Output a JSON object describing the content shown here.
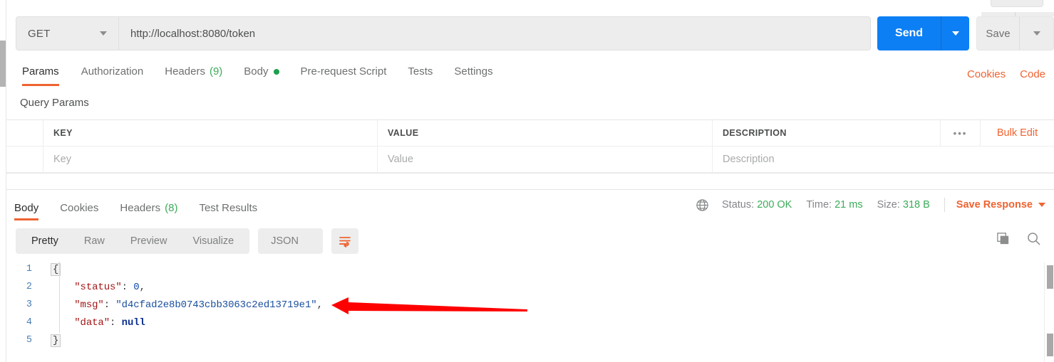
{
  "request": {
    "method": "GET",
    "url": "http://localhost:8080/token",
    "send_label": "Send",
    "save_label": "Save"
  },
  "request_tabs": [
    {
      "label": "Params",
      "count": "",
      "active": true,
      "dot": false
    },
    {
      "label": "Authorization",
      "count": "",
      "active": false,
      "dot": false
    },
    {
      "label": "Headers",
      "count": "(9)",
      "active": false,
      "dot": false
    },
    {
      "label": "Body",
      "count": "",
      "active": false,
      "dot": true
    },
    {
      "label": "Pre-request Script",
      "count": "",
      "active": false,
      "dot": false
    },
    {
      "label": "Tests",
      "count": "",
      "active": false,
      "dot": false
    },
    {
      "label": "Settings",
      "count": "",
      "active": false,
      "dot": false
    }
  ],
  "header_links": [
    {
      "label": "Cookies"
    },
    {
      "label": "Code"
    }
  ],
  "query_params": {
    "title": "Query Params",
    "columns": [
      "KEY",
      "VALUE",
      "DESCRIPTION"
    ],
    "row_placeholders": [
      "Key",
      "Value",
      "Description"
    ],
    "dots_label": "•••",
    "bulk_edit_label": "Bulk Edit"
  },
  "response_tabs": [
    {
      "label": "Body",
      "count": "",
      "active": true
    },
    {
      "label": "Cookies",
      "count": "",
      "active": false
    },
    {
      "label": "Headers",
      "count": "(8)",
      "active": false
    },
    {
      "label": "Test Results",
      "count": "",
      "active": false
    }
  ],
  "status_bar": {
    "status_label": "Status:",
    "status_value": "200 OK",
    "time_label": "Time:",
    "time_value": "21 ms",
    "size_label": "Size:",
    "size_value": "318 B",
    "save_response_label": "Save Response"
  },
  "body_toolbar": {
    "views": [
      {
        "label": "Pretty",
        "active": true
      },
      {
        "label": "Raw",
        "active": false
      },
      {
        "label": "Preview",
        "active": false
      },
      {
        "label": "Visualize",
        "active": false
      }
    ],
    "format": "JSON"
  },
  "response_body": {
    "lines": [
      {
        "no": "1",
        "html": "<span class=\"fold-box\">{</span>"
      },
      {
        "no": "2",
        "html": "    <span class=\"tok-key\">\"status\"</span><span class=\"tok-punct\">: </span><span class=\"tok-num\">0</span><span class=\"tok-punct\">,</span>"
      },
      {
        "no": "3",
        "html": "    <span class=\"tok-key\">\"msg\"</span><span class=\"tok-punct\">: </span><span class=\"tok-str\">\"d4cfad2e8b0743cbb3063c2ed13719e1\"</span><span class=\"tok-punct\">,</span>"
      },
      {
        "no": "4",
        "html": "    <span class=\"tok-key\">\"data\"</span><span class=\"tok-punct\">: </span><span class=\"tok-null\">null</span>"
      },
      {
        "no": "5",
        "html": "<span class=\"fold-box\">}</span>"
      }
    ],
    "raw_text": "{\n    \"status\": 0,\n    \"msg\": \"d4cfad2e8b0743cbb3063c2ed13719e1\",\n    \"data\": null\n}"
  },
  "colors": {
    "accent_orange": "#ef6331",
    "send_blue": "#0d7ff4",
    "success_green": "#3cab5a",
    "annotation_red": "#ff0000"
  }
}
